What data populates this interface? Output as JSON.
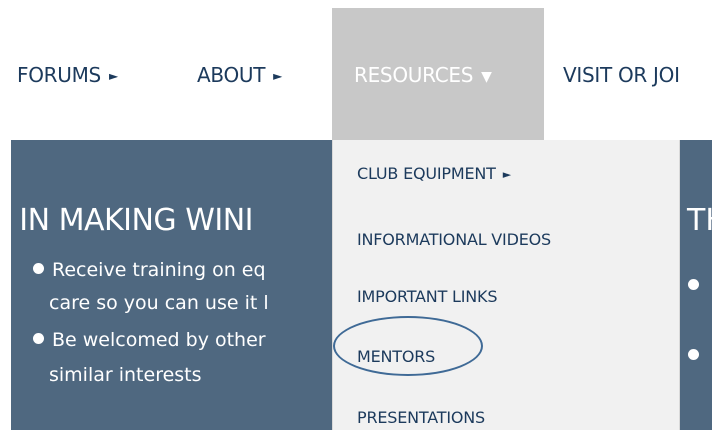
{
  "nav": {
    "forums": {
      "label": "FORUMS",
      "arrow": "►"
    },
    "about": {
      "label": "ABOUT",
      "arrow": "►"
    },
    "resources": {
      "label": "RESOURCES",
      "arrow": "▼",
      "active_bg": "#c8c8c8"
    },
    "visit": {
      "label": "VISIT OR JOI"
    }
  },
  "hero": {
    "heading": ") IN MAKING WINI",
    "heading_right": "TH",
    "lines": [
      "Receive training on eq",
      "care so you can use it l",
      "Be welcomed by other",
      "similar interests"
    ],
    "background": "#4f6880"
  },
  "dropdown": {
    "items": [
      {
        "label": "CLUB EQUIPMENT",
        "arrow": "►"
      },
      {
        "label": "INFORMATIONAL VIDEOS"
      },
      {
        "label": "IMPORTANT LINKS"
      },
      {
        "label": "MENTORS",
        "circled": true
      },
      {
        "label": "PRESENTATIONS"
      }
    ]
  },
  "colors": {
    "nav_text": "#1c3a5c",
    "ring": "#3f6a96"
  }
}
